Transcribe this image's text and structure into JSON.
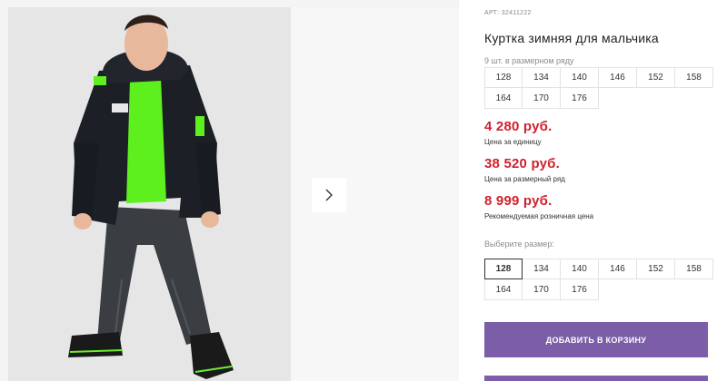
{
  "product": {
    "article": "АРТ: 32411222",
    "title": "Куртка зимняя для мальчика",
    "set_count": "9 шт. в размерном ряду",
    "set_sizes": [
      "128",
      "134",
      "140",
      "146",
      "152",
      "158",
      "164",
      "170",
      "176"
    ],
    "prices": [
      {
        "value": "4 280 руб.",
        "caption": "Цена за единицу"
      },
      {
        "value": "38 520 руб.",
        "caption": "Цена за размерный ряд"
      },
      {
        "value": "8 999 руб.",
        "caption": "Рекомендуемая розничная цена"
      }
    ],
    "size_prompt": "Выберите размер:",
    "pick_sizes": [
      "128",
      "134",
      "140",
      "146",
      "152",
      "158",
      "164",
      "170",
      "176"
    ],
    "selected_size": "128",
    "add_to_cart": "ДОБАВИТЬ В КОРЗИНУ"
  },
  "gallery": {
    "next_icon": "chevron-right-icon"
  },
  "colors": {
    "price": "#d0202c",
    "button": "#7b5ea7",
    "jacket": "#1c1f26",
    "accent_green": "#5ef01e"
  }
}
